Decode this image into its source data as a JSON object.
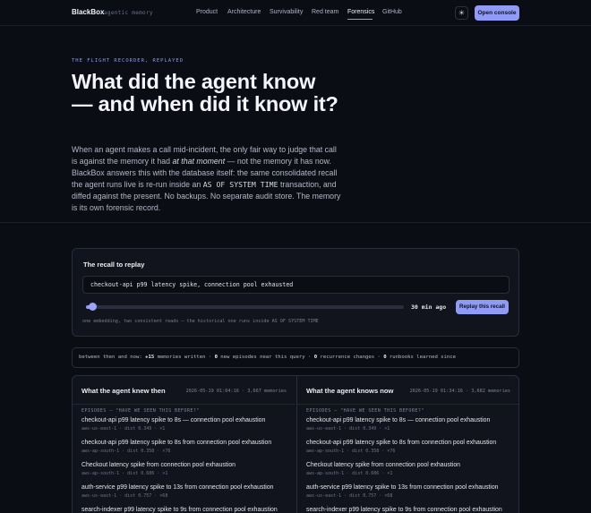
{
  "nav": {
    "brand": "BlackBox",
    "brand_sub": "agentic memory",
    "links": [
      {
        "label": "Product"
      },
      {
        "label": "Architecture"
      },
      {
        "label": "Survivability"
      },
      {
        "label": "Red team"
      },
      {
        "label": "Forensics",
        "active": true
      },
      {
        "label": "GitHub"
      }
    ],
    "theme_icon": "sun-icon",
    "theme_glyph": "☀",
    "cta": "Open console"
  },
  "hero": {
    "kicker": "THE FLIGHT RECORDER, REPLAYED",
    "title": "What did the agent know — and when did it know it?",
    "body_1": "When an agent makes a call mid-incident, the only fair way to judge that call is against the memory it had ",
    "body_em": "at that moment",
    "body_2": " — not the memory it has now. BlackBox answers this with the database itself: the same consolidated recall the agent runs live is re-run inside an ",
    "body_code": "AS OF SYSTEM TIME",
    "body_3": " transaction, and diffed against the present. No backups. No separate audit store. The memory is its own forensic record."
  },
  "recall": {
    "title": "The recall to replay",
    "query": "checkout-api p99 latency spike, connection pool exhausted",
    "slider_label": "30 min ago",
    "slider_fraction": 0.02,
    "replay_label": "Replay this recall",
    "note": "one embedding, two consistent reads — the historical one runs inside AS OF SYSTEM TIME"
  },
  "stats": {
    "prefix": "between then and now: ",
    "memories_written_value": "+15",
    "memories_written_label": " memories written · ",
    "new_episodes_value": "0",
    "new_episodes_label": " new episodes near this query · ",
    "recurrence_value": "0",
    "recurrence_label": " recurrence changes · ",
    "runbooks_value": "0",
    "runbooks_label": " runbooks learned since"
  },
  "compare": {
    "then": {
      "title": "What the agent knew then",
      "meta": "2026-05-19 01:04:16 · 3,667 memories",
      "section": "EPISODES — \"HAVE WE SEEN THIS BEFORE?\"",
      "episodes": [
        {
          "title": "checkout-api p99 latency spike to 8s — connection pool exhaustion",
          "meta": "aws-us-east-1 · dist 0.349 · ×1"
        },
        {
          "title": "checkout-api p99 latency spike to 8s from connection pool exhaustion",
          "meta": "aws-ap-south-1 · dist 0.358 · ×76"
        },
        {
          "title": "Checkout latency spike from connection pool exhaustion",
          "meta": "aws-ap-south-1 · dist 0.686 · ×1"
        },
        {
          "title": "auth-service p99 latency spike to 13s from connection pool exhaustion",
          "meta": "aws-us-east-1 · dist 0.757 · ×68"
        },
        {
          "title": "search-indexer p99 latency spike to 9s from connection pool exhaustion",
          "meta": ""
        }
      ]
    },
    "now": {
      "title": "What the agent knows now",
      "meta": "2026-05-19 01:34:16 · 3,682 memories",
      "section": "EPISODES — \"HAVE WE SEEN THIS BEFORE?\"",
      "episodes": [
        {
          "title": "checkout-api p99 latency spike to 8s — connection pool exhaustion",
          "meta": "aws-us-east-1 · dist 0.349 · ×1"
        },
        {
          "title": "checkout-api p99 latency spike to 8s from connection pool exhaustion",
          "meta": "aws-ap-south-1 · dist 0.358 · ×76"
        },
        {
          "title": "Checkout latency spike from connection pool exhaustion",
          "meta": "aws-ap-south-1 · dist 0.686 · ×1"
        },
        {
          "title": "auth-service p99 latency spike to 13s from connection pool exhaustion",
          "meta": "aws-us-east-1 · dist 0.757 · ×68"
        },
        {
          "title": "search-indexer p99 latency spike to 9s from connection pool exhaustion",
          "meta": ""
        }
      ]
    }
  },
  "colors": {
    "accent": "#8f9bf5",
    "background": "#0b0d14",
    "panel": "#12141d"
  }
}
